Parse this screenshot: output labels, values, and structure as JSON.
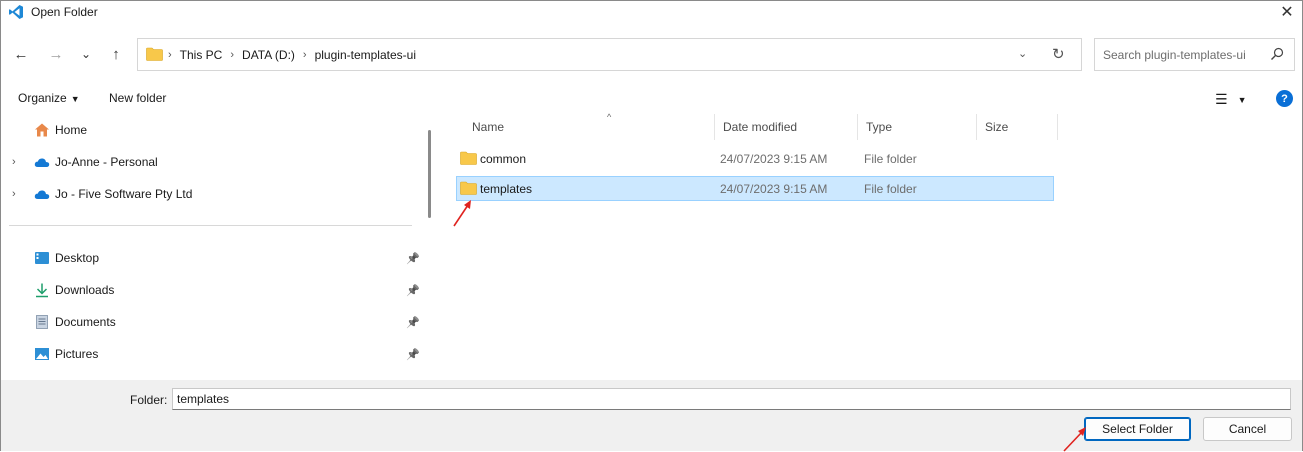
{
  "window": {
    "title": "Open Folder",
    "close_glyph": "✕"
  },
  "nav": {
    "back_glyph": "←",
    "forward_glyph": "→",
    "recent_glyph": "⌄",
    "up_glyph": "↑",
    "breadcrumbs": [
      "This PC",
      "DATA (D:)",
      "plugin-templates-ui"
    ],
    "breadcrumb_separator": "›",
    "dropdown_glyph": "⌄",
    "refresh_glyph": "↻"
  },
  "search": {
    "placeholder": "Search plugin-templates-ui"
  },
  "commands": {
    "organize_label": "Organize",
    "organize_caret": "▼",
    "new_folder_label": "New folder",
    "view_glyph": "☰",
    "view_caret": "▼",
    "help_glyph": "?"
  },
  "sidebar": {
    "items": [
      {
        "label": "Home",
        "icon": "home-icon",
        "expandable": false
      },
      {
        "label": "Jo-Anne - Personal",
        "icon": "cloud-icon",
        "expandable": true
      },
      {
        "label": "Jo - Five Software Pty Ltd",
        "icon": "cloud-icon",
        "expandable": true
      }
    ],
    "quick_access": [
      {
        "label": "Desktop",
        "icon": "desktop-icon",
        "pinned": true
      },
      {
        "label": "Downloads",
        "icon": "download-icon",
        "pinned": true
      },
      {
        "label": "Documents",
        "icon": "document-icon",
        "pinned": true
      },
      {
        "label": "Pictures",
        "icon": "picture-icon",
        "pinned": true
      }
    ],
    "expander_glyph": "›",
    "pin_glyph": "📌"
  },
  "filelist": {
    "columns": [
      "Name",
      "Date modified",
      "Type",
      "Size"
    ],
    "sort_glyph": "^",
    "rows": [
      {
        "name": "common",
        "date": "24/07/2023 9:15 AM",
        "type": "File folder",
        "selected": false
      },
      {
        "name": "templates",
        "date": "24/07/2023 9:15 AM",
        "type": "File folder",
        "selected": true
      }
    ]
  },
  "footer": {
    "folder_label": "Folder:",
    "folder_value": "templates",
    "select_button": "Select Folder",
    "cancel_button": "Cancel"
  },
  "colors": {
    "accent": "#0067c0",
    "selection": "#cce8ff",
    "folder": "#f8c84a",
    "annotation": "#e0231f"
  }
}
